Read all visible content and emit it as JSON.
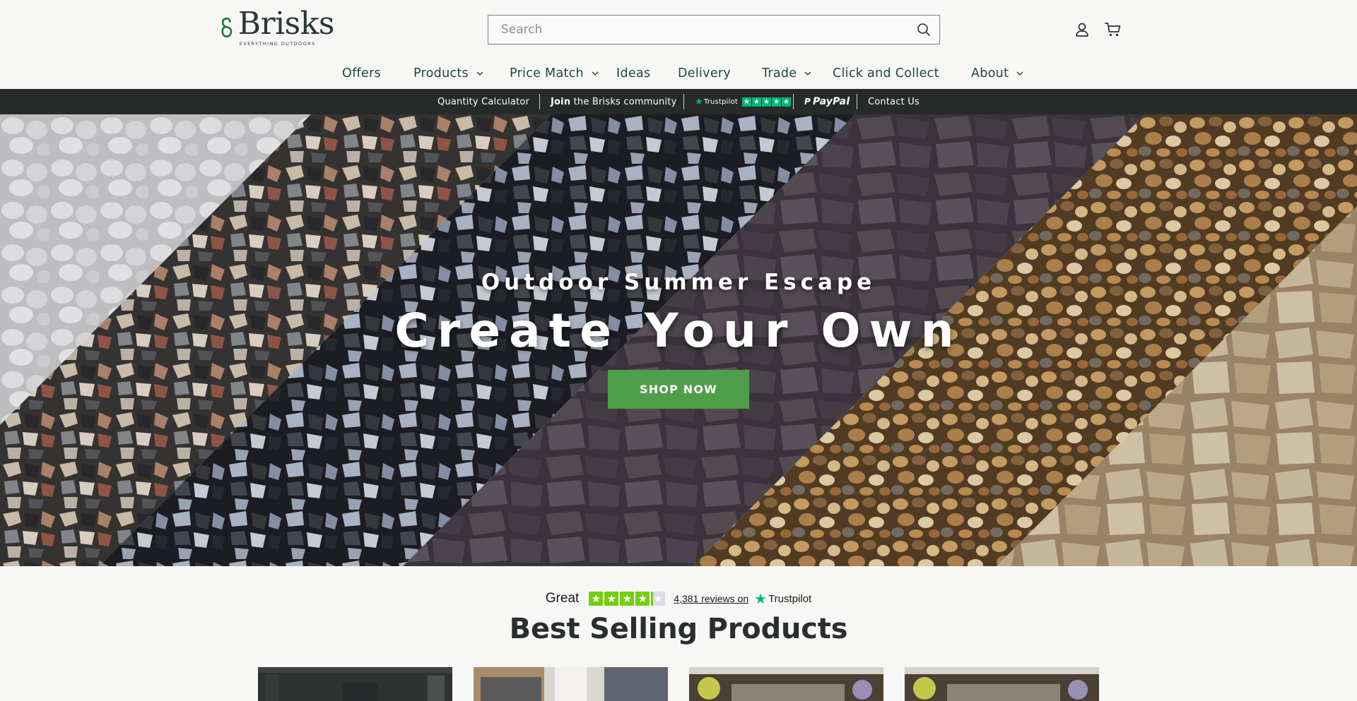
{
  "header": {
    "logo_name": "Brisks",
    "logo_tagline": "EVERYTHING OUTDOORS",
    "search_placeholder": "Search"
  },
  "nav": {
    "items": [
      {
        "label": "Offers",
        "has_dropdown": false
      },
      {
        "label": "Products",
        "has_dropdown": true
      },
      {
        "label": "Price Match",
        "has_dropdown": true
      },
      {
        "label": "Ideas",
        "has_dropdown": false
      },
      {
        "label": "Delivery",
        "has_dropdown": false
      },
      {
        "label": "Trade",
        "has_dropdown": true
      },
      {
        "label": "Click and Collect",
        "has_dropdown": false
      },
      {
        "label": "About",
        "has_dropdown": true
      }
    ]
  },
  "announcement": {
    "quantity_calculator": "Quantity Calculator",
    "join_bold": "Join",
    "join_rest": " the Brisks community",
    "trustpilot": "Trustpilot",
    "paypal": "PayPal",
    "contact": "Contact Us"
  },
  "hero": {
    "subtitle": "Outdoor Summer Escape",
    "title": "Create Your Own",
    "button": "SHOP NOW"
  },
  "trustpilot_widget": {
    "rating_word": "Great",
    "stars_filled": 4,
    "stars_total": 5,
    "reviews_link": "4,381 reviews on",
    "brand": "Trustpilot"
  },
  "best_selling": {
    "title": "Best Selling Products"
  },
  "colors": {
    "brand_green": "#1b7a3c",
    "nav_text": "#1c4a3a",
    "announcement_bg": "#262a29",
    "cta_green": "#4f9e4a",
    "trustpilot_green": "#00b67a",
    "trustpilot_rating_green": "#73cf11"
  }
}
